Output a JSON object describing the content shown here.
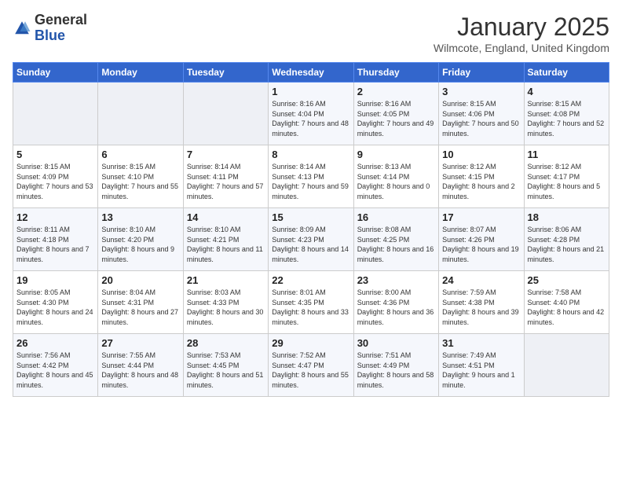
{
  "logo": {
    "general": "General",
    "blue": "Blue"
  },
  "title": "January 2025",
  "subtitle": "Wilmcote, England, United Kingdom",
  "weekdays": [
    "Sunday",
    "Monday",
    "Tuesday",
    "Wednesday",
    "Thursday",
    "Friday",
    "Saturday"
  ],
  "weeks": [
    [
      {
        "day": "",
        "sunrise": "",
        "sunset": "",
        "daylight": "",
        "empty": true
      },
      {
        "day": "",
        "sunrise": "",
        "sunset": "",
        "daylight": "",
        "empty": true
      },
      {
        "day": "",
        "sunrise": "",
        "sunset": "",
        "daylight": "",
        "empty": true
      },
      {
        "day": "1",
        "sunrise": "Sunrise: 8:16 AM",
        "sunset": "Sunset: 4:04 PM",
        "daylight": "Daylight: 7 hours and 48 minutes."
      },
      {
        "day": "2",
        "sunrise": "Sunrise: 8:16 AM",
        "sunset": "Sunset: 4:05 PM",
        "daylight": "Daylight: 7 hours and 49 minutes."
      },
      {
        "day": "3",
        "sunrise": "Sunrise: 8:15 AM",
        "sunset": "Sunset: 4:06 PM",
        "daylight": "Daylight: 7 hours and 50 minutes."
      },
      {
        "day": "4",
        "sunrise": "Sunrise: 8:15 AM",
        "sunset": "Sunset: 4:08 PM",
        "daylight": "Daylight: 7 hours and 52 minutes."
      }
    ],
    [
      {
        "day": "5",
        "sunrise": "Sunrise: 8:15 AM",
        "sunset": "Sunset: 4:09 PM",
        "daylight": "Daylight: 7 hours and 53 minutes."
      },
      {
        "day": "6",
        "sunrise": "Sunrise: 8:15 AM",
        "sunset": "Sunset: 4:10 PM",
        "daylight": "Daylight: 7 hours and 55 minutes."
      },
      {
        "day": "7",
        "sunrise": "Sunrise: 8:14 AM",
        "sunset": "Sunset: 4:11 PM",
        "daylight": "Daylight: 7 hours and 57 minutes."
      },
      {
        "day": "8",
        "sunrise": "Sunrise: 8:14 AM",
        "sunset": "Sunset: 4:13 PM",
        "daylight": "Daylight: 7 hours and 59 minutes."
      },
      {
        "day": "9",
        "sunrise": "Sunrise: 8:13 AM",
        "sunset": "Sunset: 4:14 PM",
        "daylight": "Daylight: 8 hours and 0 minutes."
      },
      {
        "day": "10",
        "sunrise": "Sunrise: 8:12 AM",
        "sunset": "Sunset: 4:15 PM",
        "daylight": "Daylight: 8 hours and 2 minutes."
      },
      {
        "day": "11",
        "sunrise": "Sunrise: 8:12 AM",
        "sunset": "Sunset: 4:17 PM",
        "daylight": "Daylight: 8 hours and 5 minutes."
      }
    ],
    [
      {
        "day": "12",
        "sunrise": "Sunrise: 8:11 AM",
        "sunset": "Sunset: 4:18 PM",
        "daylight": "Daylight: 8 hours and 7 minutes."
      },
      {
        "day": "13",
        "sunrise": "Sunrise: 8:10 AM",
        "sunset": "Sunset: 4:20 PM",
        "daylight": "Daylight: 8 hours and 9 minutes."
      },
      {
        "day": "14",
        "sunrise": "Sunrise: 8:10 AM",
        "sunset": "Sunset: 4:21 PM",
        "daylight": "Daylight: 8 hours and 11 minutes."
      },
      {
        "day": "15",
        "sunrise": "Sunrise: 8:09 AM",
        "sunset": "Sunset: 4:23 PM",
        "daylight": "Daylight: 8 hours and 14 minutes."
      },
      {
        "day": "16",
        "sunrise": "Sunrise: 8:08 AM",
        "sunset": "Sunset: 4:25 PM",
        "daylight": "Daylight: 8 hours and 16 minutes."
      },
      {
        "day": "17",
        "sunrise": "Sunrise: 8:07 AM",
        "sunset": "Sunset: 4:26 PM",
        "daylight": "Daylight: 8 hours and 19 minutes."
      },
      {
        "day": "18",
        "sunrise": "Sunrise: 8:06 AM",
        "sunset": "Sunset: 4:28 PM",
        "daylight": "Daylight: 8 hours and 21 minutes."
      }
    ],
    [
      {
        "day": "19",
        "sunrise": "Sunrise: 8:05 AM",
        "sunset": "Sunset: 4:30 PM",
        "daylight": "Daylight: 8 hours and 24 minutes."
      },
      {
        "day": "20",
        "sunrise": "Sunrise: 8:04 AM",
        "sunset": "Sunset: 4:31 PM",
        "daylight": "Daylight: 8 hours and 27 minutes."
      },
      {
        "day": "21",
        "sunrise": "Sunrise: 8:03 AM",
        "sunset": "Sunset: 4:33 PM",
        "daylight": "Daylight: 8 hours and 30 minutes."
      },
      {
        "day": "22",
        "sunrise": "Sunrise: 8:01 AM",
        "sunset": "Sunset: 4:35 PM",
        "daylight": "Daylight: 8 hours and 33 minutes."
      },
      {
        "day": "23",
        "sunrise": "Sunrise: 8:00 AM",
        "sunset": "Sunset: 4:36 PM",
        "daylight": "Daylight: 8 hours and 36 minutes."
      },
      {
        "day": "24",
        "sunrise": "Sunrise: 7:59 AM",
        "sunset": "Sunset: 4:38 PM",
        "daylight": "Daylight: 8 hours and 39 minutes."
      },
      {
        "day": "25",
        "sunrise": "Sunrise: 7:58 AM",
        "sunset": "Sunset: 4:40 PM",
        "daylight": "Daylight: 8 hours and 42 minutes."
      }
    ],
    [
      {
        "day": "26",
        "sunrise": "Sunrise: 7:56 AM",
        "sunset": "Sunset: 4:42 PM",
        "daylight": "Daylight: 8 hours and 45 minutes."
      },
      {
        "day": "27",
        "sunrise": "Sunrise: 7:55 AM",
        "sunset": "Sunset: 4:44 PM",
        "daylight": "Daylight: 8 hours and 48 minutes."
      },
      {
        "day": "28",
        "sunrise": "Sunrise: 7:53 AM",
        "sunset": "Sunset: 4:45 PM",
        "daylight": "Daylight: 8 hours and 51 minutes."
      },
      {
        "day": "29",
        "sunrise": "Sunrise: 7:52 AM",
        "sunset": "Sunset: 4:47 PM",
        "daylight": "Daylight: 8 hours and 55 minutes."
      },
      {
        "day": "30",
        "sunrise": "Sunrise: 7:51 AM",
        "sunset": "Sunset: 4:49 PM",
        "daylight": "Daylight: 8 hours and 58 minutes."
      },
      {
        "day": "31",
        "sunrise": "Sunrise: 7:49 AM",
        "sunset": "Sunset: 4:51 PM",
        "daylight": "Daylight: 9 hours and 1 minute."
      },
      {
        "day": "",
        "sunrise": "",
        "sunset": "",
        "daylight": "",
        "empty": true
      }
    ]
  ]
}
